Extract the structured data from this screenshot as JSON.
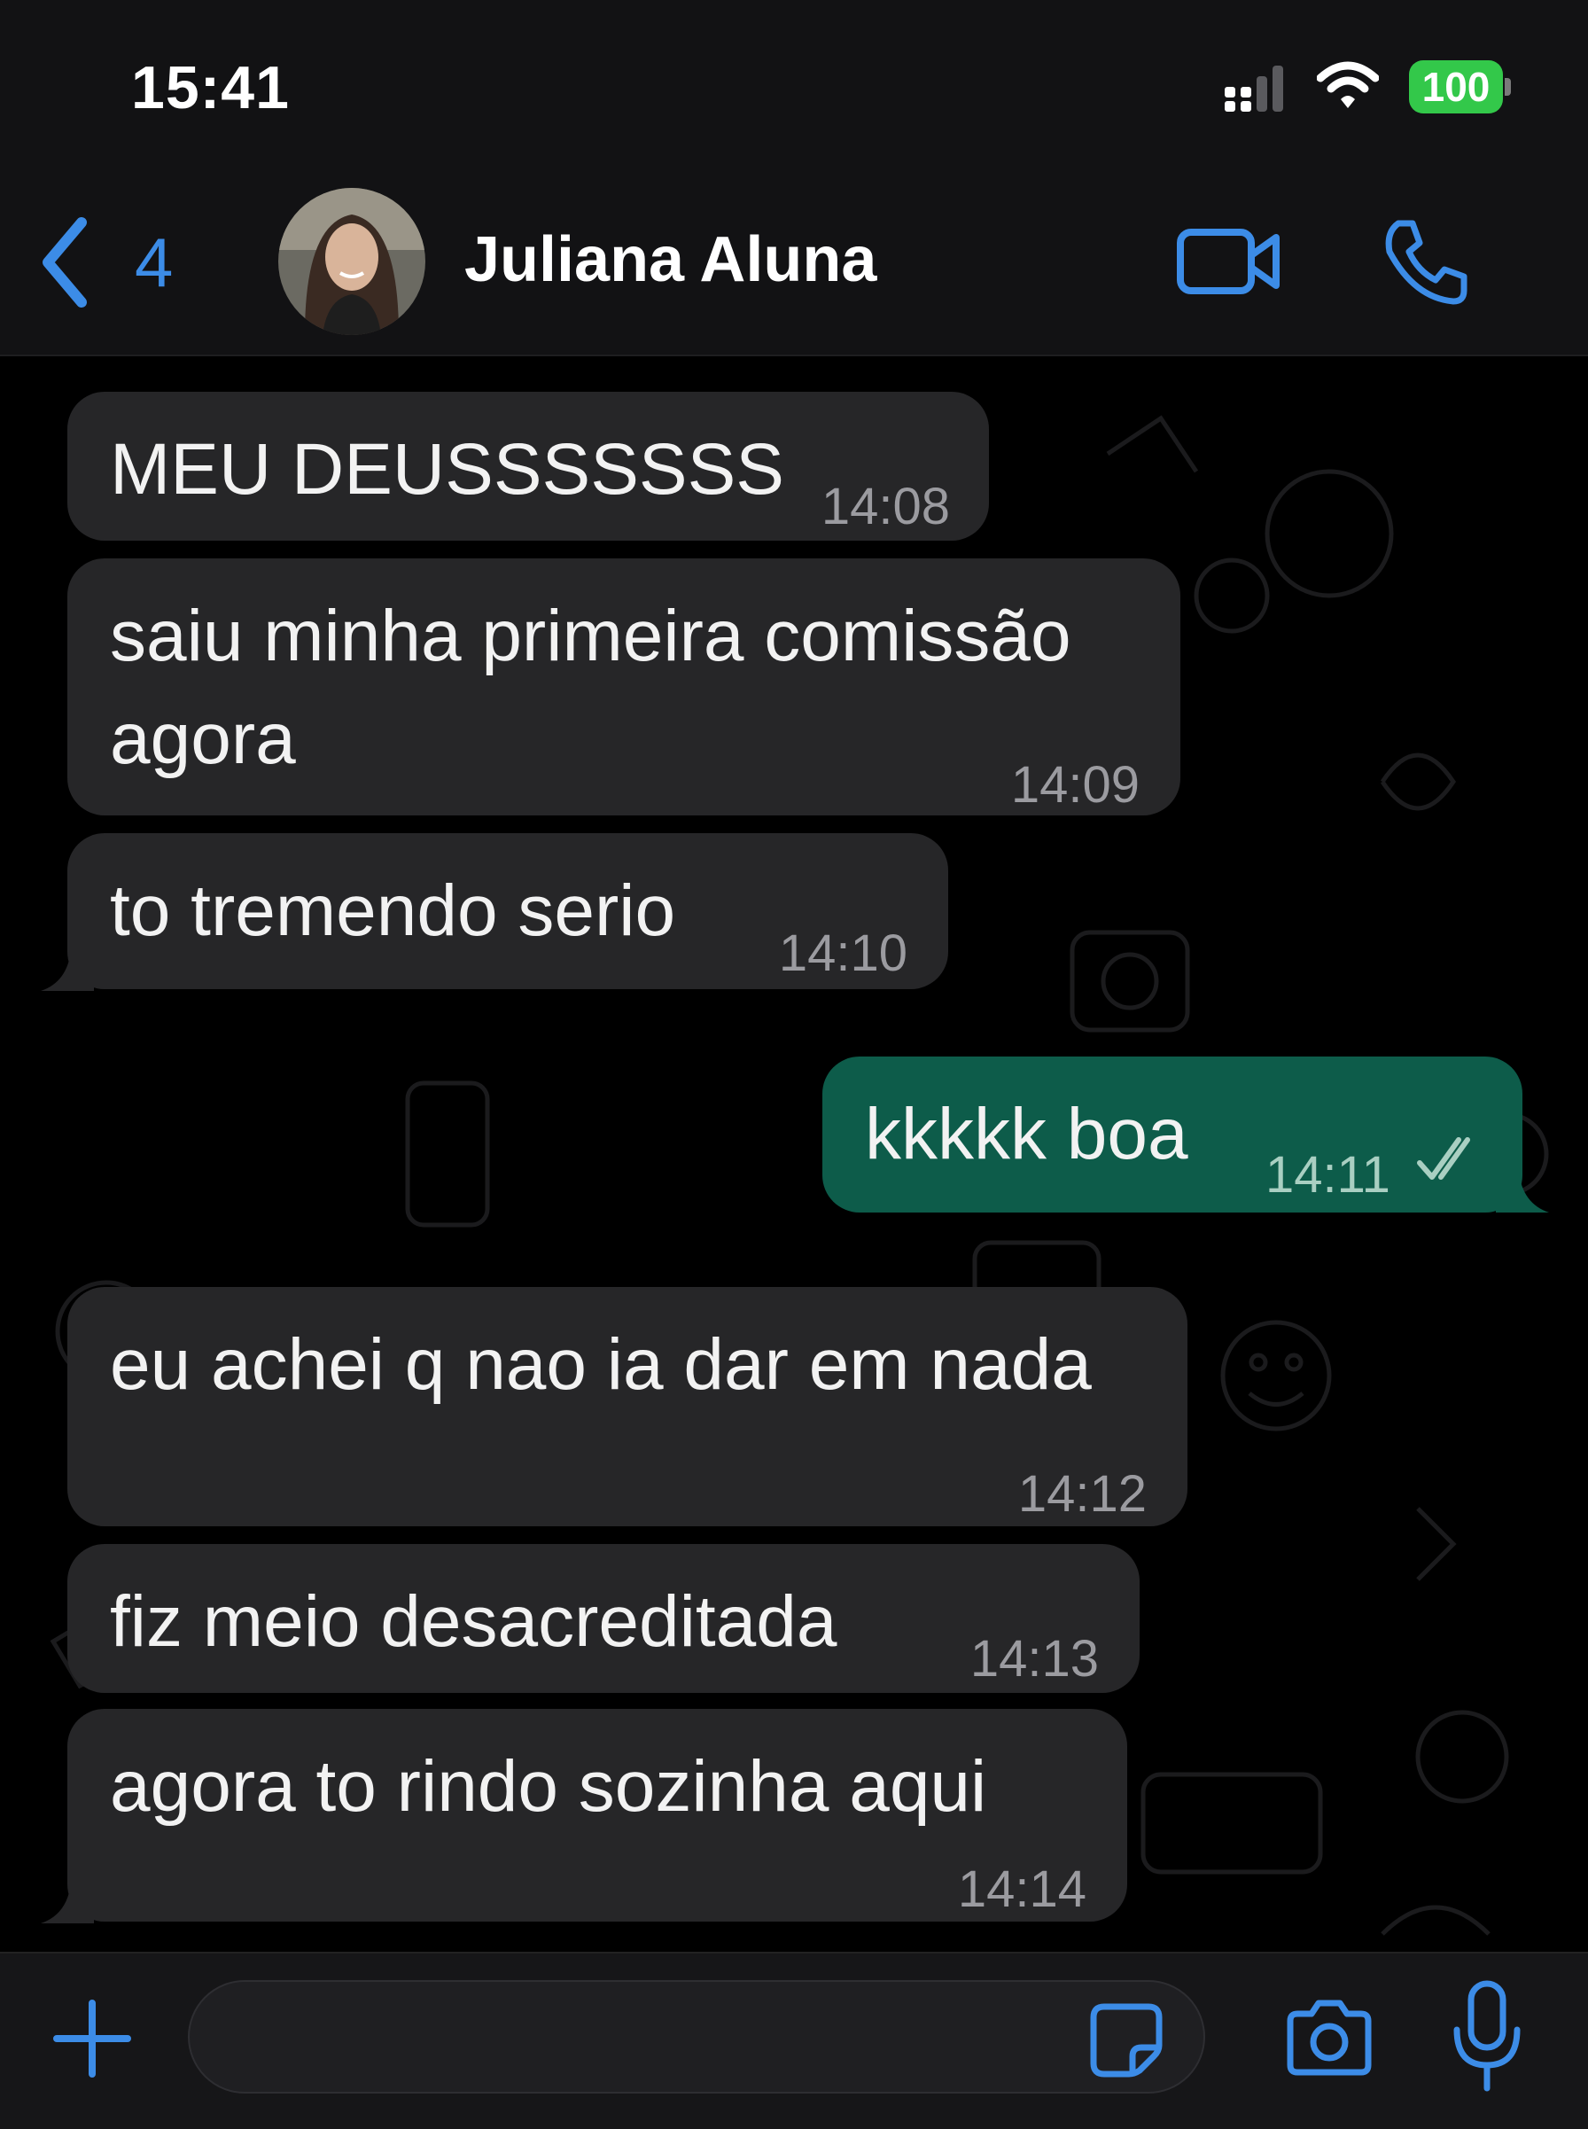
{
  "status_bar": {
    "time": "15:41",
    "battery": "100",
    "icons": [
      "signal-icon",
      "wifi-icon",
      "battery-icon"
    ]
  },
  "header": {
    "back_count": "4",
    "contact_name": "Juliana Aluna",
    "icons": [
      "chevron-left-icon",
      "video-camera-icon",
      "phone-icon"
    ]
  },
  "messages": [
    {
      "direction": "in",
      "text": "MEU DEUSSSSSSS",
      "time": "14:08"
    },
    {
      "direction": "in",
      "text": "saiu minha primeira comissão",
      "text2": "agora",
      "time": "14:09"
    },
    {
      "direction": "in",
      "text": "to tremendo serio",
      "time": "14:10"
    },
    {
      "direction": "out",
      "text": "kkkkk boa",
      "time": "14:11",
      "status": "read"
    },
    {
      "direction": "in",
      "text": "eu achei q nao ia dar em nada",
      "time": "14:12"
    },
    {
      "direction": "in",
      "text": "fiz meio desacreditada",
      "time": "14:13"
    },
    {
      "direction": "in",
      "text": "agora to rindo sozinha aqui",
      "time": "14:14"
    }
  ],
  "input_bar": {
    "placeholder": "",
    "icons": [
      "plus-icon",
      "sticker-icon",
      "camera-icon",
      "microphone-icon"
    ]
  },
  "colors": {
    "accent": "#3c8ce7",
    "incoming_bubble": "#262628",
    "outgoing_bubble": "#0d5c4a",
    "battery": "#33c84a"
  }
}
